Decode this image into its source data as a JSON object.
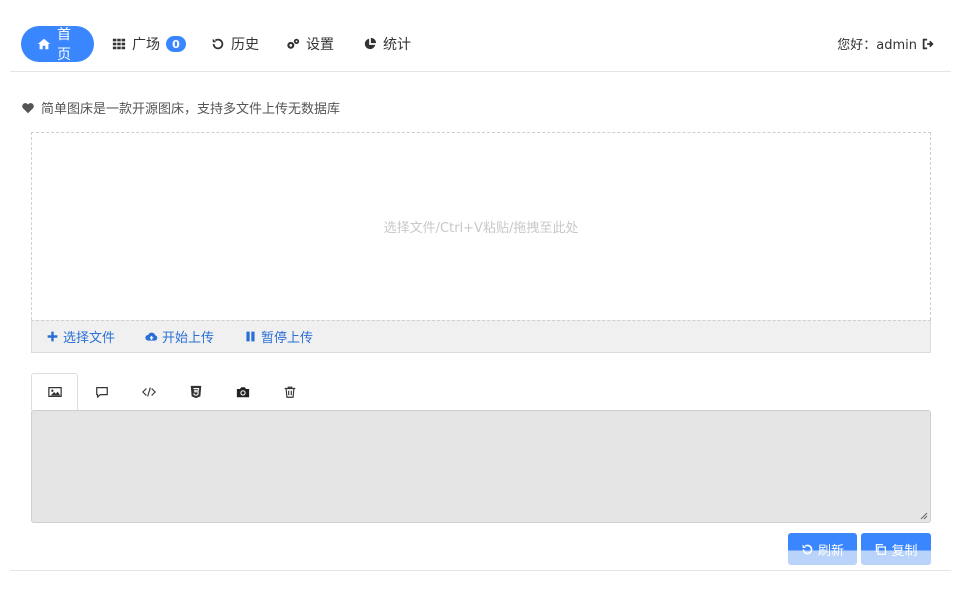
{
  "nav": {
    "home": "首页",
    "plaza": "广场",
    "plaza_count": "0",
    "history": "历史",
    "settings": "设置",
    "stats": "统计",
    "greeting": "您好：admin"
  },
  "intro": "简单图床是一款开源图床，支持多文件上传无数据库",
  "dropzone": {
    "hint": "选择文件/Ctrl+V粘贴/拖拽至此处"
  },
  "upload": {
    "choose": "选择文件",
    "start": "开始上传",
    "pause": "暂停上传"
  },
  "tabs": [
    "image-icon",
    "comment-icon",
    "code-icon",
    "html5-icon",
    "camera-icon",
    "trash-icon"
  ],
  "actions": {
    "refresh": "刷新",
    "copy": "复制"
  },
  "colors": {
    "accent": "#3a86ff",
    "link": "#2a6fd6"
  }
}
